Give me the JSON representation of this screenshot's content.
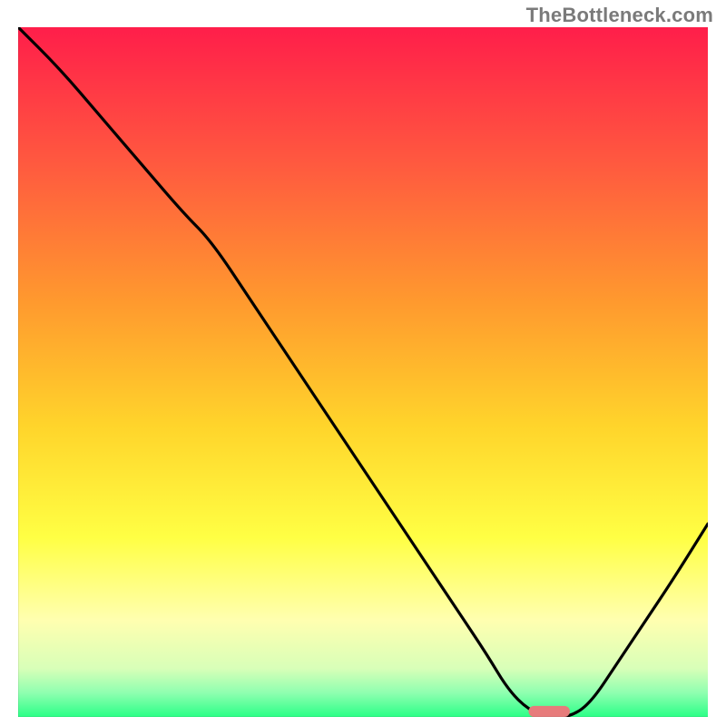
{
  "watermark": "TheBottleneck.com",
  "chart_data": {
    "type": "line",
    "title": "",
    "xlabel": "",
    "ylabel": "",
    "xlim": [
      0,
      100
    ],
    "ylim": [
      0,
      100
    ],
    "grid": false,
    "legend": false,
    "background_gradient": {
      "stops": [
        {
          "offset": 0.0,
          "color": "#ff1e4a"
        },
        {
          "offset": 0.2,
          "color": "#ff5a3f"
        },
        {
          "offset": 0.4,
          "color": "#ff9a2e"
        },
        {
          "offset": 0.58,
          "color": "#ffd52b"
        },
        {
          "offset": 0.74,
          "color": "#ffff44"
        },
        {
          "offset": 0.86,
          "color": "#ffffb0"
        },
        {
          "offset": 0.93,
          "color": "#d8ffb8"
        },
        {
          "offset": 0.965,
          "color": "#8fffb0"
        },
        {
          "offset": 1.0,
          "color": "#2bff87"
        }
      ]
    },
    "series": [
      {
        "name": "bottleneck-curve",
        "color": "#000000",
        "width": 2.0,
        "x": [
          0,
          6,
          12,
          18,
          24,
          28,
          34,
          40,
          46,
          52,
          58,
          64,
          68,
          71,
          74,
          77,
          80,
          83,
          87,
          91,
          95,
          100
        ],
        "y": [
          100,
          94,
          87,
          80,
          73,
          69,
          60,
          51,
          42,
          33,
          24,
          15,
          9,
          4,
          1,
          0,
          0,
          2,
          8,
          14,
          20,
          28
        ]
      }
    ],
    "marker": {
      "name": "optimal-range",
      "color": "#e77b7b",
      "x_center": 77,
      "y": 0.8,
      "width_x": 6,
      "height_y": 1.6,
      "rx": 2
    }
  }
}
